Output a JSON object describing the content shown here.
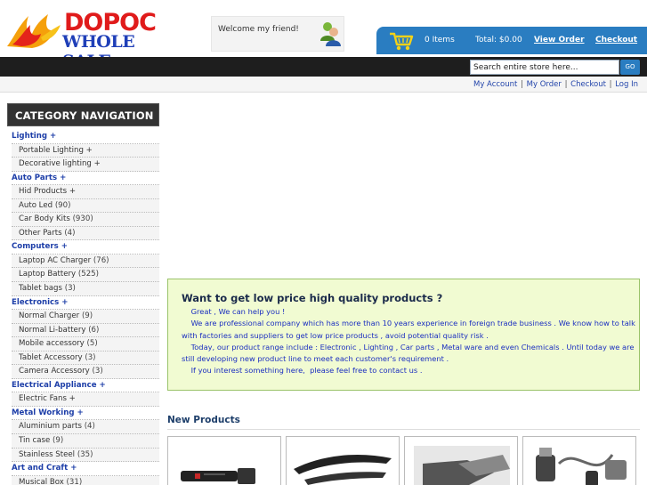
{
  "logo": {
    "line1": "DOPOC",
    "line2": "WHOLE SALE"
  },
  "welcome": {
    "text": "Welcome my friend!"
  },
  "cart": {
    "items": "0 Items",
    "total": "Total: $0.00",
    "view_order": "View Order",
    "checkout": "Checkout"
  },
  "search": {
    "value": "Search entire store here...",
    "button": "GO"
  },
  "toplinks": [
    "My Account",
    "My Order",
    "Checkout",
    "Log In"
  ],
  "sidebar": {
    "title": "CATEGORY NAVIGATION",
    "rows": [
      {
        "label": "Lighting +",
        "count": "",
        "level": "top"
      },
      {
        "label": "Portable Lighting +",
        "count": "",
        "level": "sub"
      },
      {
        "label": "Decorative lighting +",
        "count": "",
        "level": "sub"
      },
      {
        "label": "Auto Parts +",
        "count": "",
        "level": "top"
      },
      {
        "label": "Hid Products +",
        "count": "",
        "level": "sub"
      },
      {
        "label": "Auto Led",
        "count": "(90)",
        "level": "sub"
      },
      {
        "label": "Car Body Kits",
        "count": "(930)",
        "level": "sub"
      },
      {
        "label": "Other Parts",
        "count": "(4)",
        "level": "sub"
      },
      {
        "label": "Computers +",
        "count": "",
        "level": "top"
      },
      {
        "label": "Laptop AC Charger",
        "count": "(76)",
        "level": "sub"
      },
      {
        "label": "Laptop Battery",
        "count": "(525)",
        "level": "sub"
      },
      {
        "label": "Tablet bags",
        "count": "(3)",
        "level": "sub"
      },
      {
        "label": "Electronics +",
        "count": "",
        "level": "top"
      },
      {
        "label": "Normal Charger",
        "count": "(9)",
        "level": "sub"
      },
      {
        "label": "Normal Li-battery",
        "count": "(6)",
        "level": "sub"
      },
      {
        "label": "Mobile accessory",
        "count": "(5)",
        "level": "sub"
      },
      {
        "label": "Tablet Accessory",
        "count": "(3)",
        "level": "sub"
      },
      {
        "label": "Camera Accessory",
        "count": "(3)",
        "level": "sub"
      },
      {
        "label": "Electrical Appliance +",
        "count": "",
        "level": "top"
      },
      {
        "label": "Electric Fans +",
        "count": "",
        "level": "sub"
      },
      {
        "label": "Metal Working +",
        "count": "",
        "level": "top"
      },
      {
        "label": "Aluminium parts",
        "count": "(4)",
        "level": "sub"
      },
      {
        "label": "Tin case",
        "count": "(9)",
        "level": "sub"
      },
      {
        "label": "Stainless Steel",
        "count": "(35)",
        "level": "sub"
      },
      {
        "label": "Art and Craft +",
        "count": "",
        "level": "top"
      },
      {
        "label": "Musical Box",
        "count": "(31)",
        "level": "sub"
      }
    ]
  },
  "promo": {
    "title": "Want to get low price high quality products ?",
    "lines": [
      "    Great , We can help you !",
      "    We are professional company which has more than 10 years experience in foreign trade business . We know how to talk",
      "with factories and suppliers to get low price products , avoid potential quality risk .",
      "    Today, our product range include : Electronic , Lighting , Car parts , Metal ware and even Chemicals . Until today we are",
      "still developing new product line to meet each customer's requirement .",
      "    If you interest something here,  please feel free to contact us ."
    ]
  },
  "new_products": {
    "title": "New Products"
  },
  "colors": {
    "brand_blue": "#2a7dc1",
    "dark_bar": "#1e1e1e",
    "link_blue": "#1d3ea8",
    "promo_bg": "#f1fbd2"
  }
}
